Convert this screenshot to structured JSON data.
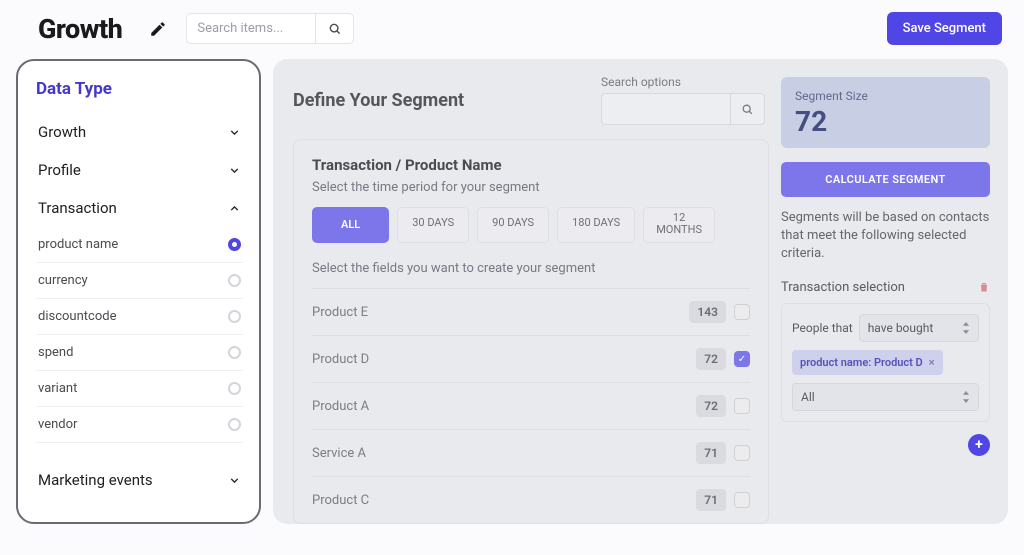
{
  "header": {
    "title": "Growth",
    "search_placeholder": "Search items...",
    "save_label": "Save Segment"
  },
  "sidebar": {
    "title": "Data Type",
    "groups": [
      {
        "label": "Growth",
        "expanded": false
      },
      {
        "label": "Profile",
        "expanded": false
      },
      {
        "label": "Transaction",
        "expanded": true
      },
      {
        "label": "Marketing events",
        "expanded": false
      }
    ],
    "transaction_items": [
      {
        "label": "product name",
        "selected": true
      },
      {
        "label": "currency",
        "selected": false
      },
      {
        "label": "discountcode",
        "selected": false
      },
      {
        "label": "spend",
        "selected": false
      },
      {
        "label": "variant",
        "selected": false
      },
      {
        "label": "vendor",
        "selected": false
      }
    ]
  },
  "center": {
    "title": "Define Your Segment",
    "search_options_label": "Search options",
    "card_title": "Transaction / Product Name",
    "time_label": "Select the time period for your segment",
    "chips": [
      {
        "label": "ALL",
        "active": true
      },
      {
        "label": "30 DAYS",
        "active": false
      },
      {
        "label": "90 DAYS",
        "active": false
      },
      {
        "label": "180 DAYS",
        "active": false
      },
      {
        "label": "12\nMONTHS",
        "active": false
      }
    ],
    "fields_label": "Select the fields you want to create your segment",
    "rows": [
      {
        "name": "Product E",
        "count": "143",
        "checked": false
      },
      {
        "name": "Product D",
        "count": "72",
        "checked": true
      },
      {
        "name": "Product A",
        "count": "72",
        "checked": false
      },
      {
        "name": "Service A",
        "count": "71",
        "checked": false
      },
      {
        "name": "Product C",
        "count": "71",
        "checked": false
      }
    ]
  },
  "right": {
    "size_label": "Segment Size",
    "size_value": "72",
    "calc_label": "CALCULATE SEGMENT",
    "help_text": "Segments will be based on contacts that meet the following selected criteria.",
    "selection_title": "Transaction selection",
    "people_label": "People that",
    "people_select": "have bought",
    "tag_text": "product name: Product D",
    "all_select": "All"
  }
}
